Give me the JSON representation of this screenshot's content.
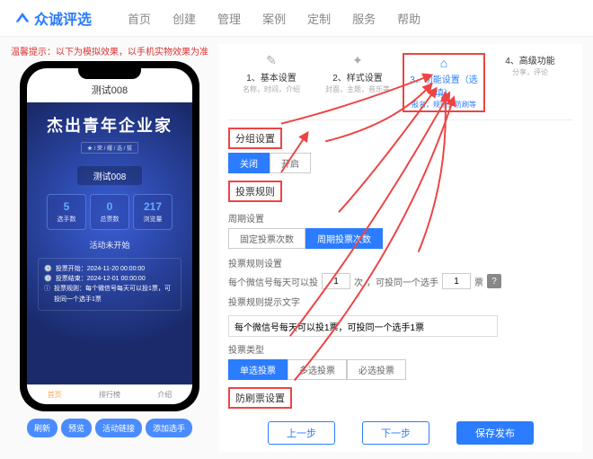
{
  "brand": "众诚评选",
  "nav": [
    "首页",
    "创建",
    "管理",
    "案例",
    "定制",
    "服务",
    "帮助"
  ],
  "warning": "温馨提示：以下为模拟效果，以手机实物效果为准",
  "phone": {
    "title": "测试008",
    "hero_title": "杰出青年企业家",
    "hero_sub": "★ / 荣 / 耀 / 选 / 拔",
    "badge": "测试008",
    "stats": [
      {
        "num": "5",
        "lbl": "选手数"
      },
      {
        "num": "0",
        "lbl": "总票数"
      },
      {
        "num": "217",
        "lbl": "浏览量"
      }
    ],
    "status": "活动未开始",
    "info": [
      {
        "k": "投票开始：",
        "v": "2024-11-20 00:00:00"
      },
      {
        "k": "投票结束：",
        "v": "2024-12-01 00:00:00"
      },
      {
        "k": "投票规则：",
        "v": "每个微信号每天可以投1票，可投同一个选手1票"
      }
    ],
    "tabs": [
      "首页",
      "排行榜",
      "介绍"
    ]
  },
  "actions": [
    "刷新",
    "预览",
    "活动链接",
    "添加选手"
  ],
  "steps": [
    {
      "title": "1、基本设置",
      "sub": "名称，时间，介绍"
    },
    {
      "title": "2、样式设置",
      "sub": "封面，主题，音乐等"
    },
    {
      "title": "3、功能设置（选填）",
      "sub": "报名，规则，防刷等"
    },
    {
      "title": "4、高级功能",
      "sub": "分享，评论"
    }
  ],
  "group": {
    "label": "分组设置",
    "off": "关闭",
    "on": "开启"
  },
  "vote_rules": "投票规则",
  "cycle": {
    "label": "周期设置",
    "fixed": "固定投票次数",
    "periodic": "周期投票次数"
  },
  "rule_set": {
    "label": "投票规则设置",
    "p1": "每个微信号每天可以投",
    "v1": "1",
    "p2": "次",
    "p3": "，可投同一个选手",
    "v2": "1",
    "p4": "票"
  },
  "hint": {
    "label": "投票规则提示文字",
    "value": "每个微信号每天可以投1票，可投同一个选手1票"
  },
  "vote_type": {
    "label": "投票类型",
    "opts": [
      "单选投票",
      "多选投票",
      "必选投票"
    ]
  },
  "anti": "防刷票设置",
  "footer": {
    "prev": "上一步",
    "next": "下一步",
    "save": "保存发布"
  }
}
